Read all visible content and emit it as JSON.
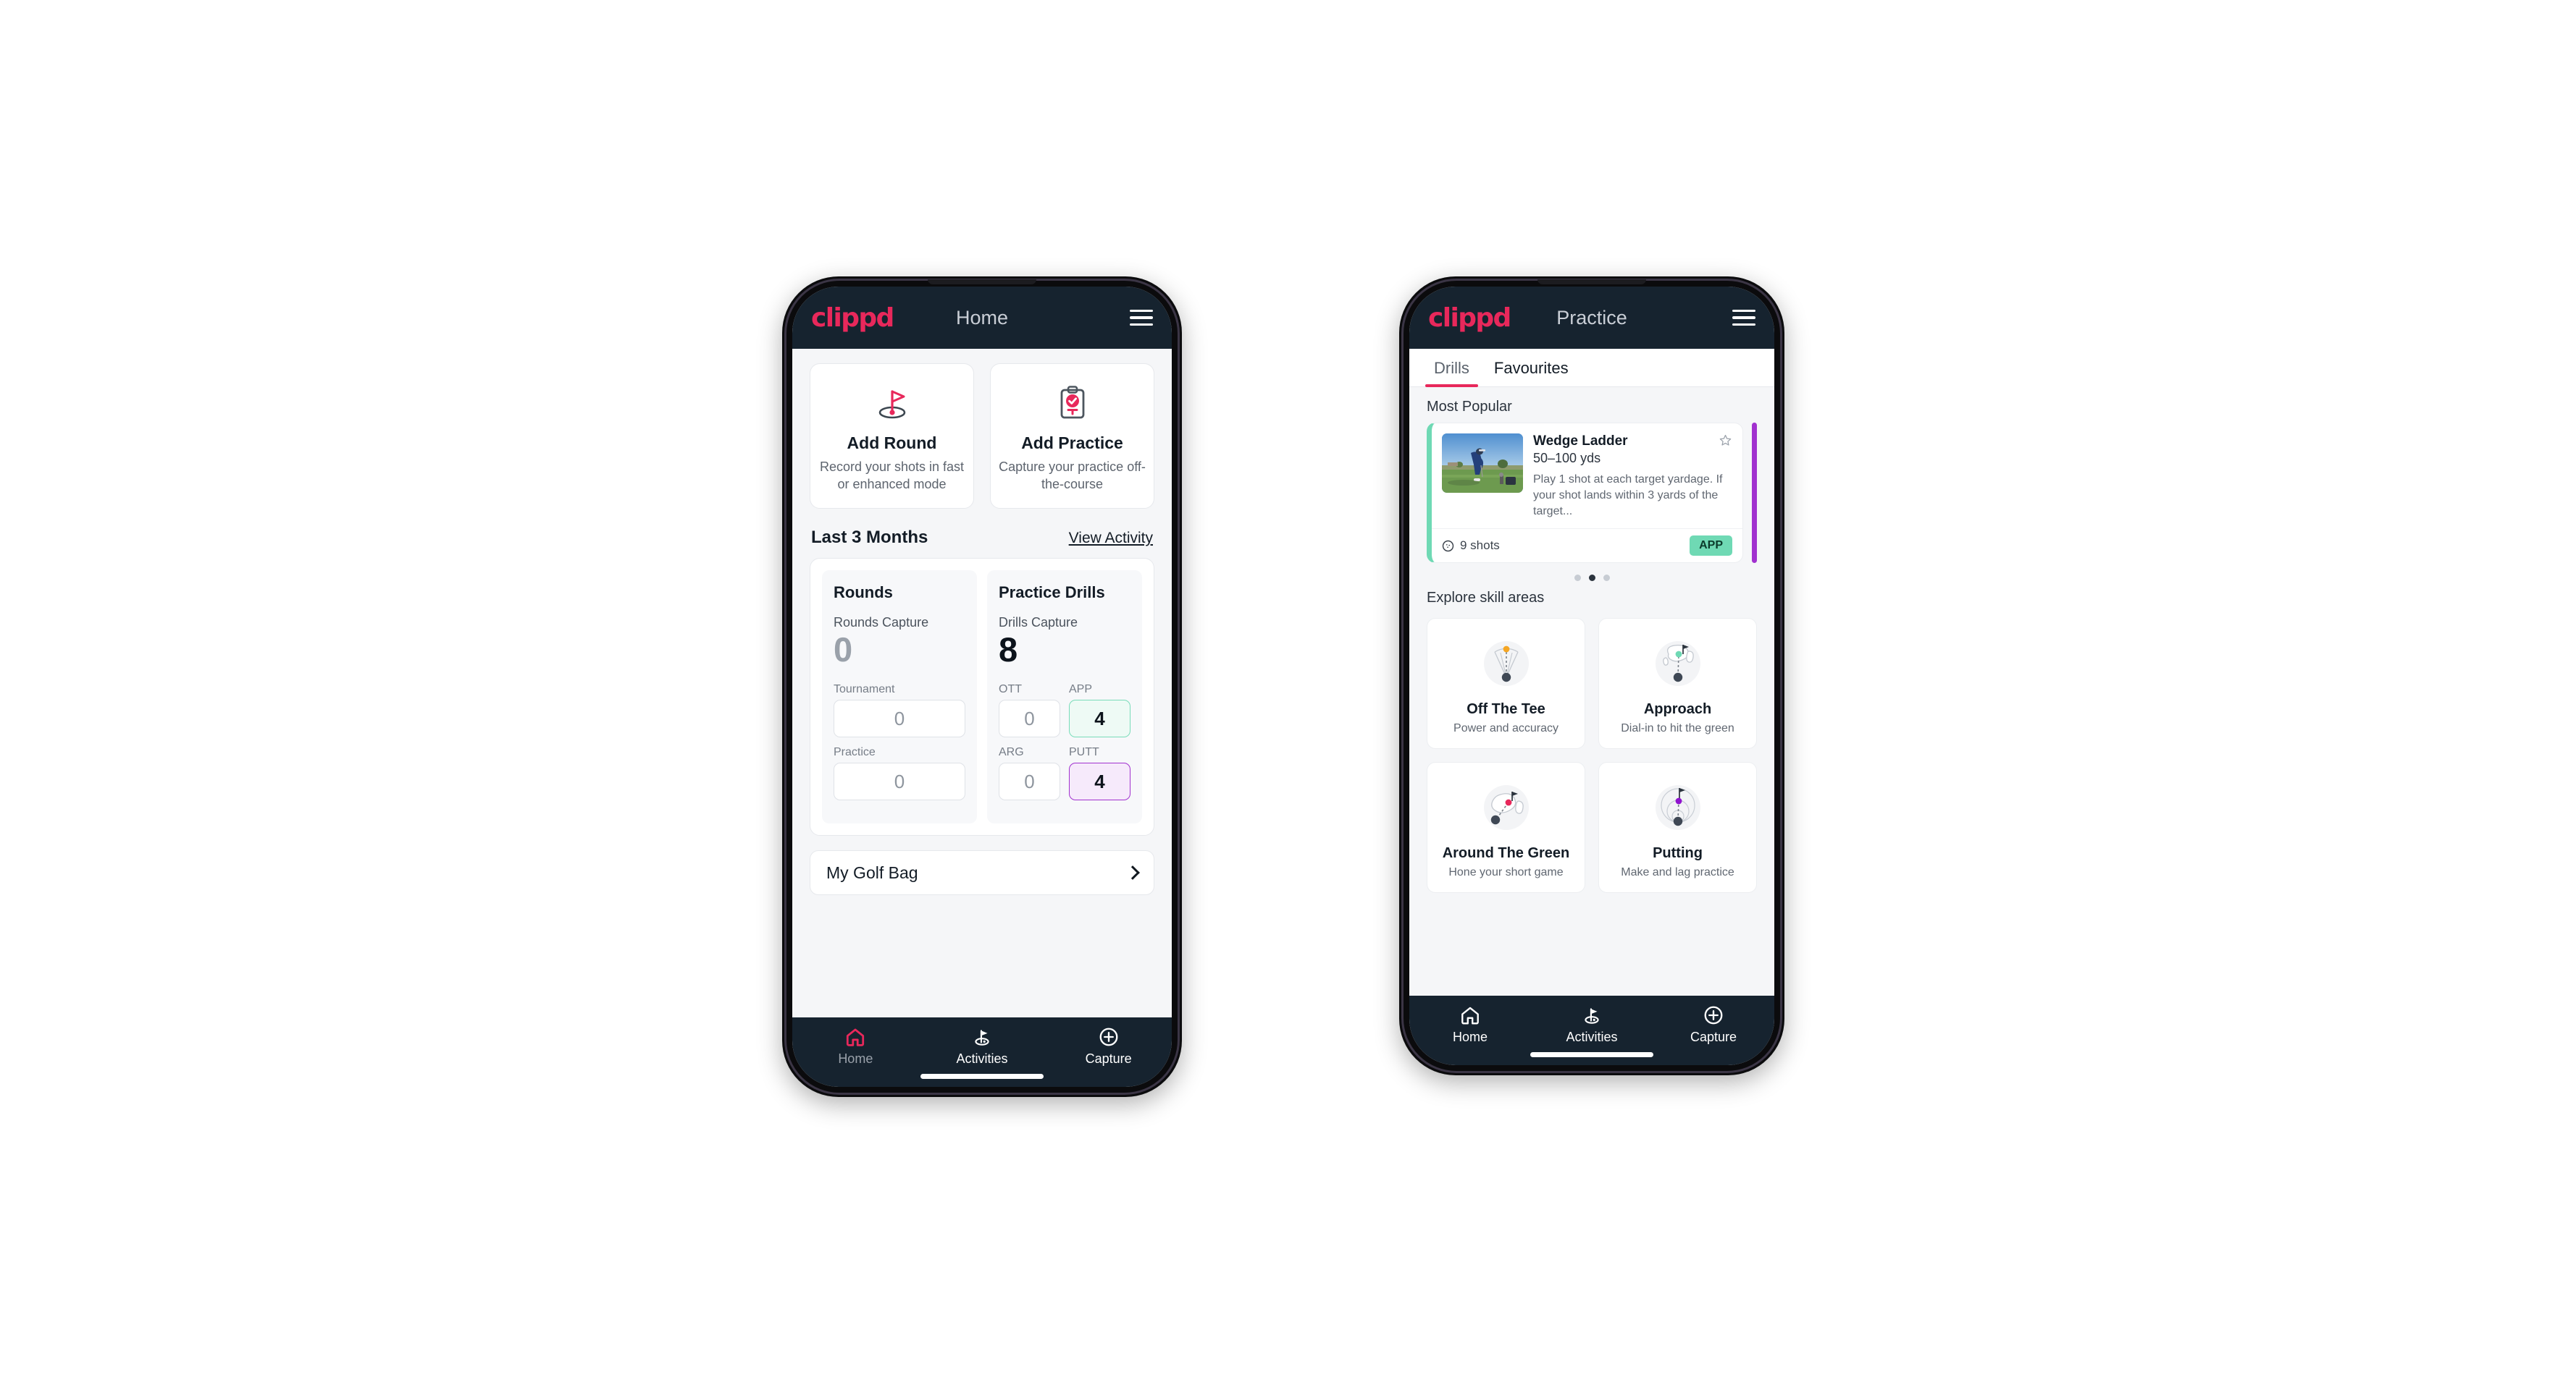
{
  "brand": {
    "logo_text": "clippd",
    "accent_pink": "#e8285b",
    "header_bg": "#16232f",
    "green": "#6fd9b4",
    "purple": "#a131cf"
  },
  "home_phone": {
    "appbar": {
      "title": "Home",
      "menu_icon": "hamburger-icon"
    },
    "actions": [
      {
        "icon": "golf-flag-icon",
        "title": "Add Round",
        "subtitle": "Record your shots in fast or enhanced mode"
      },
      {
        "icon": "clipboard-check-icon",
        "title": "Add Practice",
        "subtitle": "Capture your practice off-the-course"
      }
    ],
    "section": {
      "title": "Last 3 Months",
      "link": "View Activity"
    },
    "rounds": {
      "title": "Rounds",
      "capture_label": "Rounds Capture",
      "capture_value": "0",
      "fields": [
        {
          "label": "Tournament",
          "value": "0",
          "state": "empty"
        },
        {
          "label": "Practice",
          "value": "0",
          "state": "empty"
        }
      ]
    },
    "drills": {
      "title": "Practice Drills",
      "capture_label": "Drills Capture",
      "capture_value": "8",
      "fields": [
        {
          "label": "OTT",
          "value": "0",
          "state": "empty"
        },
        {
          "label": "APP",
          "value": "4",
          "state": "app"
        },
        {
          "label": "ARG",
          "value": "0",
          "state": "empty"
        },
        {
          "label": "PUTT",
          "value": "4",
          "state": "putt"
        }
      ]
    },
    "golf_bag": {
      "label": "My Golf Bag",
      "icon": "chevron-right-icon"
    },
    "nav": [
      {
        "label": "Home",
        "icon": "home-icon",
        "active": true
      },
      {
        "label": "Activities",
        "icon": "golf-flag-icon",
        "active": false
      },
      {
        "label": "Capture",
        "icon": "plus-circle-icon",
        "active": false
      }
    ]
  },
  "practice_phone": {
    "appbar": {
      "title": "Practice",
      "menu_icon": "hamburger-icon"
    },
    "tabs": [
      {
        "label": "Drills",
        "active": true
      },
      {
        "label": "Favourites",
        "active": false
      }
    ],
    "most_popular_label": "Most Popular",
    "drill": {
      "name": "Wedge Ladder",
      "yardage": "50–100 yds",
      "description": "Play 1 shot at each target yardage. If your shot lands within 3 yards of the target...",
      "shots": "9 shots",
      "shots_icon": "golf-ball-icon",
      "badge": "APP",
      "favourite_icon": "star-outline-icon",
      "thumbnail": "golfer-on-range-photo"
    },
    "carousel_dots": {
      "count": 3,
      "active_index": 1
    },
    "explore_label": "Explore skill areas",
    "skills": [
      {
        "title": "Off The Tee",
        "subtitle": "Power and accuracy",
        "icon": "tee-fan-icon",
        "dot_color": "#f5a623"
      },
      {
        "title": "Approach",
        "subtitle": "Dial-in to hit the green",
        "icon": "green-approach-icon",
        "dot_color": "#6fd9b4"
      },
      {
        "title": "Around The Green",
        "subtitle": "Hone your short game",
        "icon": "chip-green-icon",
        "dot_color": "#e8285b"
      },
      {
        "title": "Putting",
        "subtitle": "Make and lag practice",
        "icon": "putting-rings-icon",
        "dot_color": "#9013cf"
      }
    ],
    "nav": [
      {
        "label": "Home",
        "icon": "home-icon",
        "active": false
      },
      {
        "label": "Activities",
        "icon": "golf-flag-icon",
        "active": true
      },
      {
        "label": "Capture",
        "icon": "plus-circle-icon",
        "active": false
      }
    ]
  }
}
